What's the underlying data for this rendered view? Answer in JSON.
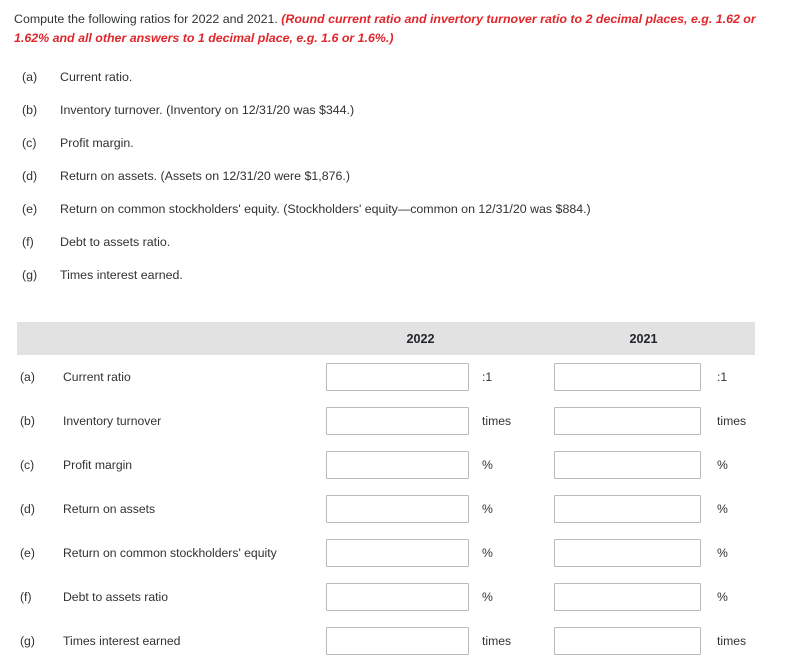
{
  "instructions": {
    "lead": "Compute the following ratios for 2022 and 2021.",
    "note_line1": "(Round current ratio and invertory turnover ratio to 2 decimal places, e.g. 1.62 or 1.62%",
    "note_line2": "and all other answers to 1 decimal place, e.g. 1.6 or 1.6%.)",
    "note_color": "#e0262b"
  },
  "requirements": [
    {
      "key": "(a)",
      "text": "Current ratio."
    },
    {
      "key": "(b)",
      "text": "Inventory turnover. (Inventory on 12/31/20 was $344.)"
    },
    {
      "key": "(c)",
      "text": "Profit margin."
    },
    {
      "key": "(d)",
      "text": "Return on assets. (Assets on 12/31/20 were $1,876.)"
    },
    {
      "key": "(e)",
      "text": "Return on common stockholders' equity. (Stockholders' equity—common on 12/31/20 was $884.)"
    },
    {
      "key": "(f)",
      "text": "Debt to assets ratio."
    },
    {
      "key": "(g)",
      "text": "Times interest earned."
    }
  ],
  "answer_table": {
    "header": {
      "blank": "",
      "year_2022": "2022",
      "year_2021": "2021"
    },
    "header_bg": "#e2e2e2",
    "rows": [
      {
        "key": "(a)",
        "label": "Current ratio",
        "value_2022": "",
        "unit_2022": ":1",
        "value_2021": "",
        "unit_2021": ":1"
      },
      {
        "key": "(b)",
        "label": "Inventory turnover",
        "value_2022": "",
        "unit_2022": "times",
        "value_2021": "",
        "unit_2021": "times"
      },
      {
        "key": "(c)",
        "label": "Profit margin",
        "value_2022": "",
        "unit_2022": "%",
        "value_2021": "",
        "unit_2021": "%"
      },
      {
        "key": "(d)",
        "label": "Return on assets",
        "value_2022": "",
        "unit_2022": "%",
        "value_2021": "",
        "unit_2021": "%"
      },
      {
        "key": "(e)",
        "label": "Return on common stockholders' equity",
        "value_2022": "",
        "unit_2022": "%",
        "value_2021": "",
        "unit_2021": "%"
      },
      {
        "key": "(f)",
        "label": "Debt to assets ratio",
        "value_2022": "",
        "unit_2022": "%",
        "value_2021": "",
        "unit_2021": "%"
      },
      {
        "key": "(g)",
        "label": "Times interest earned",
        "value_2022": "",
        "unit_2022": "times",
        "value_2021": "",
        "unit_2021": "times"
      }
    ]
  }
}
